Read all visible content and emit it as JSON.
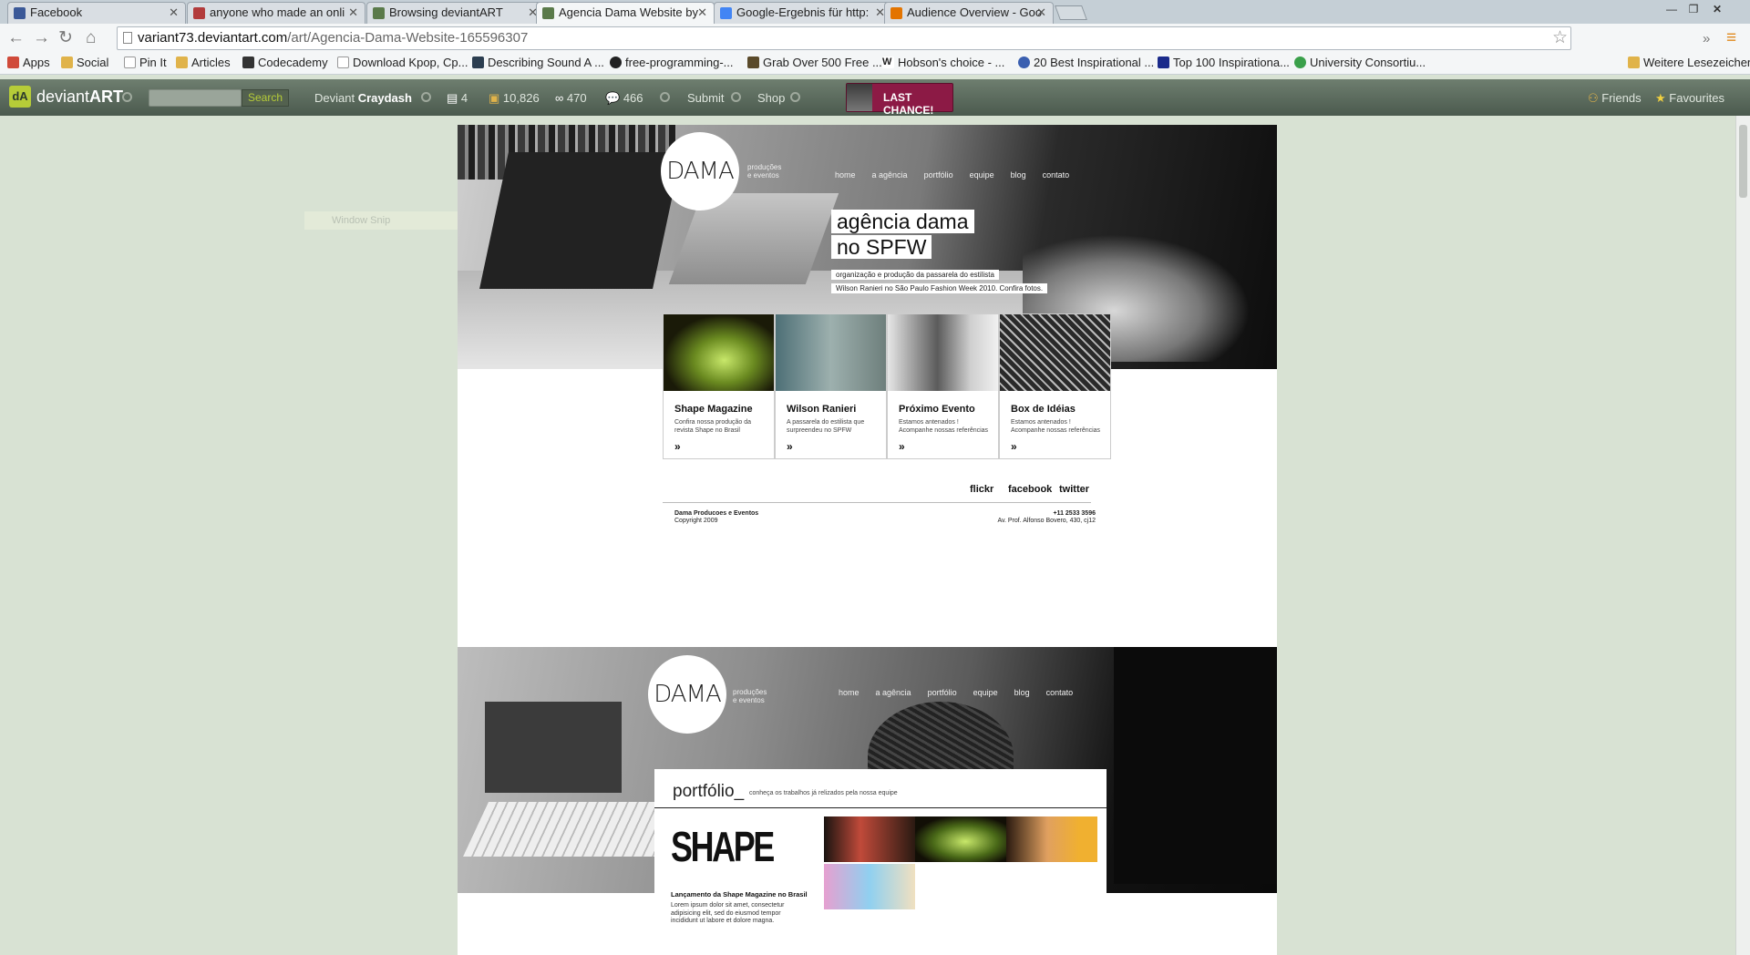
{
  "browser": {
    "tabs": [
      {
        "label": "Facebook",
        "icon": "facebook-icon",
        "color": "#3b5998",
        "active": false
      },
      {
        "label": "anyone who made an onli",
        "icon": "gift-icon",
        "color": "#b23b3b",
        "active": false
      },
      {
        "label": "Browsing deviantART",
        "icon": "deviantart-icon",
        "color": "#5a7a4a",
        "active": false
      },
      {
        "label": "Agencia Dama Website by",
        "icon": "deviantart-icon",
        "color": "#5a7a4a",
        "active": true
      },
      {
        "label": "Google-Ergebnis für http:",
        "icon": "google-icon",
        "color": "#4285f4",
        "active": false
      },
      {
        "label": "Audience Overview - Goo",
        "icon": "analytics-icon",
        "color": "#e37400",
        "active": false
      }
    ],
    "url_host": "variant73.deviantart.com",
    "url_path": "/art/Agencia-Dama-Website-165596307",
    "bookmarks": [
      {
        "label": "Apps",
        "icon": "apps-icon",
        "color": "#d04a3a"
      },
      {
        "label": "Social",
        "icon": "folder-icon",
        "color": "#e0b34a"
      },
      {
        "label": "Pin It",
        "icon": "page-icon",
        "color": "#ffffff"
      },
      {
        "label": "Articles",
        "icon": "folder-icon",
        "color": "#e0b34a"
      },
      {
        "label": "Codecademy",
        "icon": "codecademy-icon",
        "color": "#333333"
      },
      {
        "label": "Download Kpop, Cp...",
        "icon": "page-icon",
        "color": "#ffffff"
      },
      {
        "label": "Describing Sound A ...",
        "icon": "hf-icon",
        "color": "#2c3e50"
      },
      {
        "label": "free-programming-...",
        "icon": "github-icon",
        "color": "#222222"
      },
      {
        "label": "Grab Over 500 Free ...",
        "icon": "page-icon",
        "color": "#5a4a2a"
      },
      {
        "label": "Hobson's choice - ...",
        "icon": "wikipedia-icon",
        "color": "#ffffff"
      },
      {
        "label": "20 Best Inspirational ...",
        "icon": "globe-icon",
        "color": "#3a5fb0"
      },
      {
        "label": "Top 100 Inspirationa...",
        "icon": "f-icon",
        "color": "#1a2a8a"
      },
      {
        "label": "University Consortiu...",
        "icon": "chrome-icon",
        "color": "#3aa04a"
      },
      {
        "label": "Weitere Lesezeichen",
        "icon": "folder-icon",
        "color": "#e0b34a"
      }
    ]
  },
  "deviantart": {
    "logo": "deviant",
    "logo_bold": "ART",
    "search_label": "Search",
    "deviant_prefix": "Deviant",
    "username": "Craydash",
    "notes_count": "4",
    "points_count": "10,826",
    "watch_count": "470",
    "comments_count": "466",
    "submit_label": "Submit",
    "shop_label": "Shop",
    "promo_label": "LAST CHANCE!",
    "friends_label": "Friends",
    "favourites_label": "Favourites"
  },
  "overlay": {
    "window_snip": "Window Snip"
  },
  "mockup1": {
    "logo": "DAMA",
    "logo_sub": [
      "produções",
      "e eventos"
    ],
    "nav": [
      "home",
      "a agência",
      "portfólio",
      "equipe",
      "blog",
      "contato"
    ],
    "headline": [
      "agência dama",
      "no SPFW"
    ],
    "subline": [
      "organização e produção da passarela do estilista",
      "Wilson Ranieri no São Paulo Fashion Week 2010. Confira fotos."
    ],
    "cards": [
      {
        "title": "Shape Magazine",
        "desc": "Confira nossa produção da revista Shape no Brasil",
        "color": "#2b2b10"
      },
      {
        "title": "Wilson Ranieri",
        "desc": "A passarela do estilista que surpreendeu no SPFW",
        "color": "#6c8a8a"
      },
      {
        "title": "Próximo Evento",
        "desc": "Estamos antenados ! Acompanhe nossas referências",
        "color": "#9a9a9a"
      },
      {
        "title": "Box de Idéias",
        "desc": "Estamos antenados ! Acompanhe nossas referências",
        "color": "#3a3a3a"
      }
    ],
    "card_arrow": "»",
    "social": [
      "flickr",
      "facebook",
      "twitter"
    ],
    "footer_company": "Dama Producoes e Eventos",
    "footer_copyright": "Copyright 2009",
    "footer_phone": "+11 2533 3596",
    "footer_address": "Av. Prof. Alfonso Bovero, 430, cj12"
  },
  "mockup2": {
    "logo": "DAMA",
    "logo_sub": [
      "produções",
      "e eventos"
    ],
    "nav": [
      "home",
      "a agência",
      "portfólio",
      "equipe",
      "blog",
      "contato"
    ],
    "portfolio_title": "portfólio_",
    "portfolio_sub": "conheça os trabalhos já relizados pela nossa equipe",
    "shape_logo": "SHAPE",
    "item_heading": "Lançamento da Shape Magazine no Brasil",
    "item_body": "Lorem ipsum dolor sit amet, consectetur adipisicing elit, sed do eiusmod tempor incididunt ut labore et dolore magna."
  }
}
